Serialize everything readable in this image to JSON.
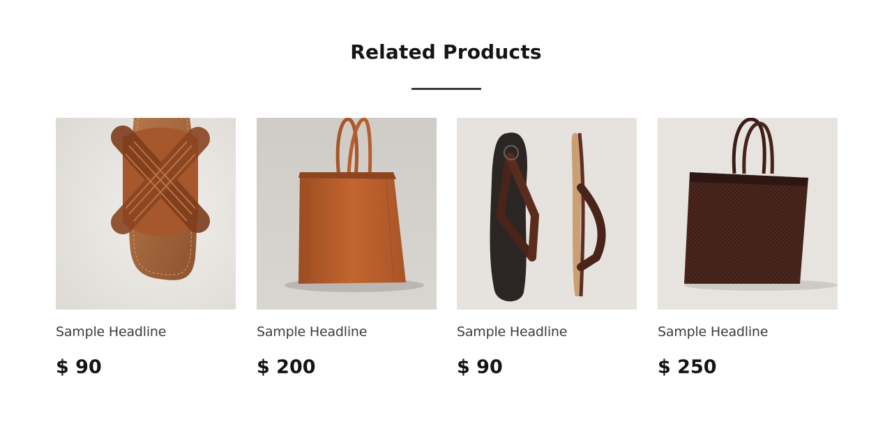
{
  "section": {
    "title": "Related Products"
  },
  "products": [
    {
      "image": "woven-leather-sandal",
      "headline": "Sample Headline",
      "price": "$ 90"
    },
    {
      "image": "tan-leather-tote-bag",
      "headline": "Sample Headline",
      "price": "$ 200"
    },
    {
      "image": "leather-flip-flop-sandals",
      "headline": "Sample Headline",
      "price": "$ 90"
    },
    {
      "image": "woven-dark-leather-tote",
      "headline": "Sample Headline",
      "price": "$ 250"
    }
  ],
  "colors": {
    "text": "#141414",
    "subtext": "#3b3b3b",
    "divider": "#3a3a3a",
    "leather_tan": "#b8622e",
    "leather_dark": "#3a1d18"
  }
}
